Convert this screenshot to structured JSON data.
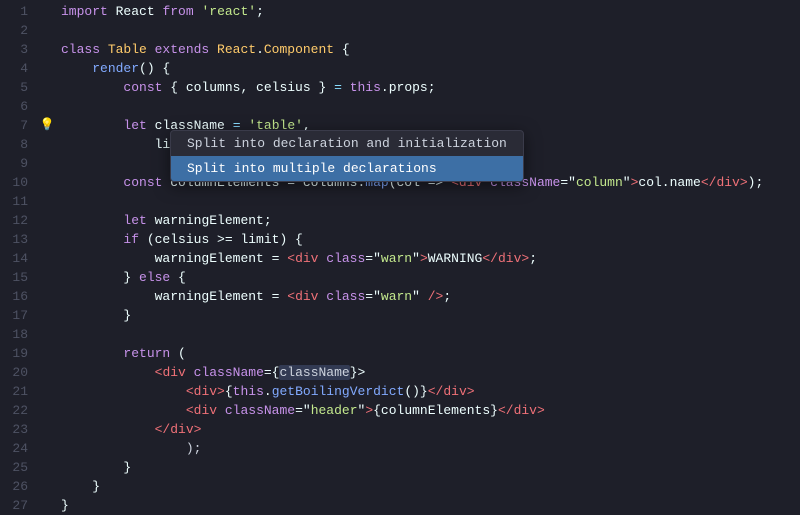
{
  "editor": {
    "background": "#1e1f29",
    "lines": [
      {
        "num": 1,
        "tokens": [
          {
            "t": "import",
            "c": "kw"
          },
          {
            "t": " React ",
            "c": "plain"
          },
          {
            "t": "from",
            "c": "kw"
          },
          {
            "t": " ",
            "c": "plain"
          },
          {
            "t": "'react'",
            "c": "str"
          },
          {
            "t": ";",
            "c": "plain"
          }
        ]
      },
      {
        "num": 2,
        "tokens": []
      },
      {
        "num": 3,
        "tokens": [
          {
            "t": "class ",
            "c": "kw"
          },
          {
            "t": "Table ",
            "c": "cls"
          },
          {
            "t": "extends ",
            "c": "kw"
          },
          {
            "t": "React",
            "c": "cls"
          },
          {
            "t": ".",
            "c": "plain"
          },
          {
            "t": "Component",
            "c": "cls"
          },
          {
            "t": " {",
            "c": "plain"
          }
        ]
      },
      {
        "num": 4,
        "tokens": [
          {
            "t": "    render",
            "c": "fn"
          },
          {
            "t": "() {",
            "c": "plain"
          }
        ]
      },
      {
        "num": 5,
        "tokens": [
          {
            "t": "        ",
            "c": "plain"
          },
          {
            "t": "const",
            "c": "kw"
          },
          {
            "t": " { columns, celsius } ",
            "c": "plain"
          },
          {
            "t": "=",
            "c": "op"
          },
          {
            "t": " ",
            "c": "plain"
          },
          {
            "t": "this",
            "c": "this-kw"
          },
          {
            "t": ".props;",
            "c": "plain"
          }
        ]
      },
      {
        "num": 6,
        "tokens": []
      },
      {
        "num": 7,
        "tokens": [
          {
            "t": "        ",
            "c": "plain"
          },
          {
            "t": "let ",
            "c": "kw"
          },
          {
            "t": "class",
            "c": "plain"
          },
          {
            "t": "Name",
            "c": "plain"
          },
          {
            "t": " = ",
            "c": "op"
          },
          {
            "t": "'table'",
            "c": "str"
          },
          {
            "t": ",",
            "c": "plain"
          }
        ],
        "hasIcon": true
      },
      {
        "num": 8,
        "tokens": [
          {
            "t": "            ",
            "c": "plain"
          },
          {
            "t": "limi",
            "c": "plain"
          }
        ]
      },
      {
        "num": 9,
        "tokens": [
          {
            "t": "        ",
            "c": "plain"
          }
        ]
      },
      {
        "num": 10,
        "tokens": [
          {
            "t": "        ",
            "c": "plain"
          },
          {
            "t": "const ",
            "c": "kw"
          },
          {
            "t": "col",
            "c": "plain"
          },
          {
            "t": "umnElements = columns.",
            "c": "plain"
          },
          {
            "t": "map",
            "c": "fn"
          },
          {
            "t": "(col => ",
            "c": "plain"
          },
          {
            "t": "<",
            "c": "jsx-tag"
          },
          {
            "t": "div ",
            "c": "jsx-tag"
          },
          {
            "t": "className",
            "c": "jsx-attr"
          },
          {
            "t": "=\"",
            "c": "plain"
          },
          {
            "t": "column",
            "c": "jsx-val"
          },
          {
            "t": "\"",
            "c": "plain"
          },
          {
            "t": ">",
            "c": "jsx-tag"
          },
          {
            "t": "col.name",
            "c": "plain"
          },
          {
            "t": "</",
            "c": "jsx-tag"
          },
          {
            "t": "div",
            "c": "jsx-tag"
          },
          {
            "t": ">",
            "c": "jsx-tag"
          },
          {
            "t": ");",
            "c": "plain"
          }
        ]
      },
      {
        "num": 11,
        "tokens": []
      },
      {
        "num": 12,
        "tokens": [
          {
            "t": "        ",
            "c": "plain"
          },
          {
            "t": "let ",
            "c": "kw"
          },
          {
            "t": "warningElement;",
            "c": "plain"
          }
        ]
      },
      {
        "num": 13,
        "tokens": [
          {
            "t": "        ",
            "c": "plain"
          },
          {
            "t": "if",
            "c": "kw"
          },
          {
            "t": " (celsius >= limit) {",
            "c": "plain"
          }
        ]
      },
      {
        "num": 14,
        "tokens": [
          {
            "t": "            ",
            "c": "plain"
          },
          {
            "t": "warningElement = ",
            "c": "plain"
          },
          {
            "t": "<",
            "c": "jsx-tag"
          },
          {
            "t": "div ",
            "c": "jsx-tag"
          },
          {
            "t": "class",
            "c": "jsx-attr"
          },
          {
            "t": "=\"",
            "c": "plain"
          },
          {
            "t": "warn",
            "c": "jsx-val"
          },
          {
            "t": "\"",
            "c": "plain"
          },
          {
            "t": ">",
            "c": "jsx-tag"
          },
          {
            "t": "WARNING",
            "c": "plain"
          },
          {
            "t": "</",
            "c": "jsx-tag"
          },
          {
            "t": "div",
            "c": "jsx-tag"
          },
          {
            "t": ">;",
            "c": "plain"
          }
        ]
      },
      {
        "num": 15,
        "tokens": [
          {
            "t": "        ",
            "c": "plain"
          },
          {
            "t": "} ",
            "c": "plain"
          },
          {
            "t": "else",
            "c": "kw"
          },
          {
            "t": " {",
            "c": "plain"
          }
        ]
      },
      {
        "num": 16,
        "tokens": [
          {
            "t": "            ",
            "c": "plain"
          },
          {
            "t": "warningElement = ",
            "c": "plain"
          },
          {
            "t": "<",
            "c": "jsx-tag"
          },
          {
            "t": "div ",
            "c": "jsx-tag"
          },
          {
            "t": "class",
            "c": "jsx-attr"
          },
          {
            "t": "=\"",
            "c": "plain"
          },
          {
            "t": "warn",
            "c": "jsx-val"
          },
          {
            "t": "\" ",
            "c": "plain"
          },
          {
            "t": "/>",
            "c": "jsx-tag"
          },
          {
            "t": ";",
            "c": "plain"
          }
        ]
      },
      {
        "num": 17,
        "tokens": [
          {
            "t": "        ",
            "c": "plain"
          },
          {
            "t": "}",
            "c": "plain"
          }
        ]
      },
      {
        "num": 18,
        "tokens": []
      },
      {
        "num": 19,
        "tokens": [
          {
            "t": "        ",
            "c": "plain"
          },
          {
            "t": "return",
            "c": "kw"
          },
          {
            "t": " (",
            "c": "plain"
          }
        ]
      },
      {
        "num": 20,
        "tokens": [
          {
            "t": "            ",
            "c": "plain"
          },
          {
            "t": "<",
            "c": "jsx-tag"
          },
          {
            "t": "div ",
            "c": "jsx-tag"
          },
          {
            "t": "className",
            "c": "jsx-attr"
          },
          {
            "t": "={",
            "c": "plain"
          },
          {
            "t": "className",
            "c": "highlight-cls"
          },
          {
            "t": "}>",
            "c": "plain"
          }
        ]
      },
      {
        "num": 21,
        "tokens": [
          {
            "t": "                ",
            "c": "plain"
          },
          {
            "t": "<",
            "c": "jsx-tag"
          },
          {
            "t": "div",
            "c": "jsx-tag"
          },
          {
            "t": ">",
            "c": "jsx-tag"
          },
          {
            "t": "{",
            "c": "plain"
          },
          {
            "t": "this",
            "c": "this-kw"
          },
          {
            "t": ".",
            "c": "plain"
          },
          {
            "t": "getBoilingVerdict",
            "c": "fn"
          },
          {
            "t": "()}",
            "c": "plain"
          },
          {
            "t": "</",
            "c": "jsx-tag"
          },
          {
            "t": "div",
            "c": "jsx-tag"
          },
          {
            "t": ">",
            "c": "jsx-tag"
          }
        ]
      },
      {
        "num": 22,
        "tokens": [
          {
            "t": "                ",
            "c": "plain"
          },
          {
            "t": "<",
            "c": "jsx-tag"
          },
          {
            "t": "div ",
            "c": "jsx-tag"
          },
          {
            "t": "className",
            "c": "jsx-attr"
          },
          {
            "t": "=\"",
            "c": "plain"
          },
          {
            "t": "header",
            "c": "jsx-val"
          },
          {
            "t": "\"",
            "c": "plain"
          },
          {
            "t": ">",
            "c": "jsx-tag"
          },
          {
            "t": "{columnElements}",
            "c": "plain"
          },
          {
            "t": "</",
            "c": "jsx-tag"
          },
          {
            "t": "div",
            "c": "jsx-tag"
          },
          {
            "t": ">",
            "c": "jsx-tag"
          }
        ]
      },
      {
        "num": 23,
        "tokens": [
          {
            "t": "            ",
            "c": "plain"
          },
          {
            "t": "</",
            "c": "jsx-tag"
          },
          {
            "t": "div",
            "c": "jsx-tag"
          },
          {
            "t": ">",
            "c": "jsx-tag"
          }
        ]
      },
      {
        "num": 24,
        "tokens": [
          {
            "t": "        ",
            "c": "plain"
          },
          {
            "t": "        );",
            "c": "plain"
          }
        ]
      },
      {
        "num": 25,
        "tokens": [
          {
            "t": "        ",
            "c": "plain"
          },
          {
            "t": "}",
            "c": "plain"
          }
        ]
      },
      {
        "num": 26,
        "tokens": [
          {
            "t": "    ",
            "c": "plain"
          },
          {
            "t": "}",
            "c": "plain"
          }
        ]
      },
      {
        "num": 27,
        "tokens": [
          {
            "t": "}",
            "c": "plain"
          }
        ]
      }
    ]
  },
  "popup": {
    "items": [
      {
        "label": "Split into declaration and initialization",
        "selected": false
      },
      {
        "label": "Split into multiple declarations",
        "selected": true
      }
    ]
  }
}
